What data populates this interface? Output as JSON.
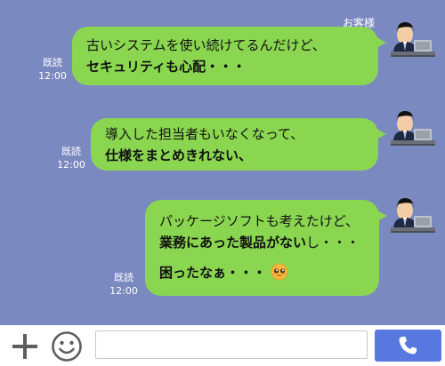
{
  "chat": {
    "contact_name": "お客様",
    "messages": [
      {
        "lines": [
          {
            "text": "古いシステムを使い続けてるんだけど、",
            "bold": false
          },
          {
            "text": "セキュリティも心配・・・",
            "bold": true
          }
        ],
        "read_label": "既読",
        "time": "12:00"
      },
      {
        "lines": [
          {
            "text": "導入した担当者もいなくなって、",
            "bold": false
          },
          {
            "text": "仕様をまとめきれない、",
            "bold": true
          }
        ],
        "read_label": "既読",
        "time": "12:00"
      },
      {
        "line1": "パッケージソフトも考えたけど、",
        "line2_bold": "業務にあった製品がない",
        "line2_rest": "し・・・",
        "line3": "困ったなぁ・・・",
        "emoji": "pleading-face-icon",
        "read_label": "既読",
        "time": "12:00"
      }
    ]
  },
  "input_bar": {
    "message_value": "",
    "message_placeholder": "",
    "icons": [
      "plus-icon",
      "smiley-icon",
      "phone-icon"
    ],
    "call_button_color": "#5878e0"
  },
  "colors": {
    "background": "#7b89c1",
    "bubble": "#8ad650"
  }
}
